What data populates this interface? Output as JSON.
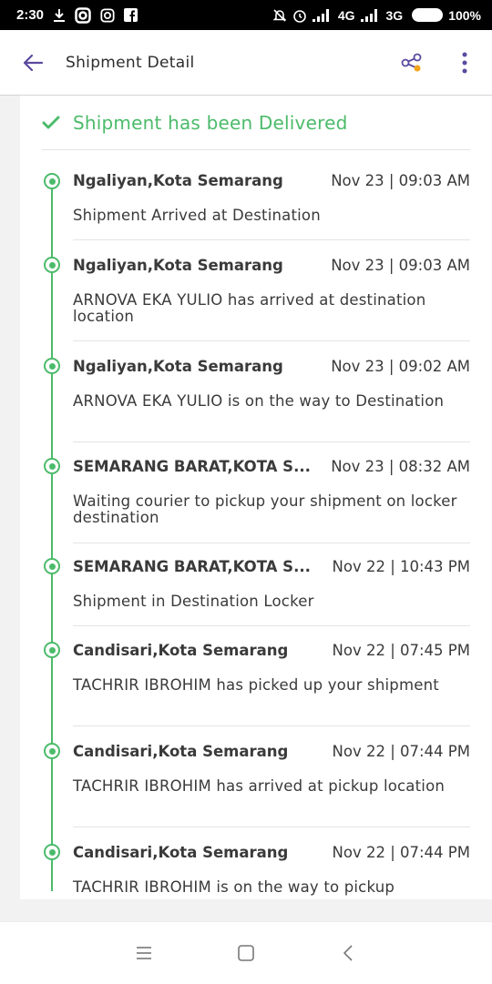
{
  "status_bar": {
    "time": "2:30",
    "network_4g": "4G",
    "network_3g": "3G",
    "battery": "100%"
  },
  "header": {
    "title": "Shipment Detail"
  },
  "delivery_status": {
    "label": "Shipment has been Delivered",
    "accent_color": "#4cbb6b"
  },
  "events": [
    {
      "location": "Ngaliyan,Kota Semarang",
      "time": "Nov 23 | 09:03 AM",
      "description": "Shipment Arrived at Destination"
    },
    {
      "location": "Ngaliyan,Kota Semarang",
      "time": "Nov 23 | 09:03 AM",
      "description": "ARNOVA EKA YULIO has arrived at destination location"
    },
    {
      "location": "Ngaliyan,Kota Semarang",
      "time": "Nov 23 | 09:02 AM",
      "description": "ARNOVA EKA YULIO is on the way to Destination"
    },
    {
      "location": "SEMARANG BARAT,KOTA S...",
      "time": "Nov 23 | 08:32 AM",
      "description": "Waiting courier to pickup your shipment on locker destination"
    },
    {
      "location": "SEMARANG BARAT,KOTA S...",
      "time": "Nov 22 | 10:43 PM",
      "description": "Shipment in Destination Locker"
    },
    {
      "location": "Candisari,Kota Semarang",
      "time": "Nov 22 | 07:45 PM",
      "description": "TACHRIR IBROHIM has picked up your shipment"
    },
    {
      "location": "Candisari,Kota Semarang",
      "time": "Nov 22 | 07:44 PM",
      "description": "TACHRIR IBROHIM has arrived at pickup location"
    },
    {
      "location": "Candisari,Kota Semarang",
      "time": "Nov 22 | 07:44 PM",
      "description": "TACHRIR IBROHIM is on the way to pickup"
    }
  ]
}
